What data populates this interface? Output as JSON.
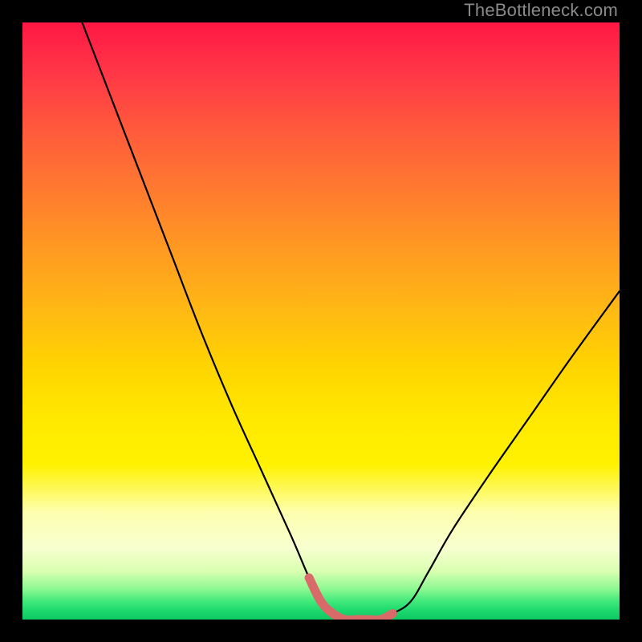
{
  "watermark": {
    "text": "TheBottleneck.com"
  },
  "chart_data": {
    "type": "line",
    "title": "",
    "xlabel": "",
    "ylabel": "",
    "xlim": [
      0,
      100
    ],
    "ylim": [
      0,
      100
    ],
    "grid": false,
    "legend": false,
    "background_gradient": {
      "direction": "top-to-bottom",
      "stops": [
        {
          "pos": 0,
          "color": "#ff1744"
        },
        {
          "pos": 50,
          "color": "#ffd500"
        },
        {
          "pos": 85,
          "color": "#fdffae"
        },
        {
          "pos": 100,
          "color": "#0cc863"
        }
      ]
    },
    "series": [
      {
        "name": "bottleneck-curve",
        "color": "#000000",
        "x": [
          10,
          15,
          20,
          25,
          30,
          35,
          40,
          45,
          48,
          50,
          52,
          55,
          58,
          60,
          62,
          65,
          68,
          72,
          78,
          85,
          92,
          100
        ],
        "y": [
          100,
          87,
          74,
          61,
          48,
          36,
          25,
          14,
          7,
          3,
          1,
          0,
          0,
          0,
          1,
          3,
          8,
          15,
          24,
          34,
          44,
          55
        ]
      },
      {
        "name": "trough-highlight",
        "color": "#e06666",
        "thick": true,
        "x": [
          48,
          50,
          52,
          54,
          56,
          58,
          60,
          62
        ],
        "y": [
          7,
          3,
          1,
          0,
          0,
          0,
          0,
          1
        ]
      }
    ],
    "annotations": []
  }
}
